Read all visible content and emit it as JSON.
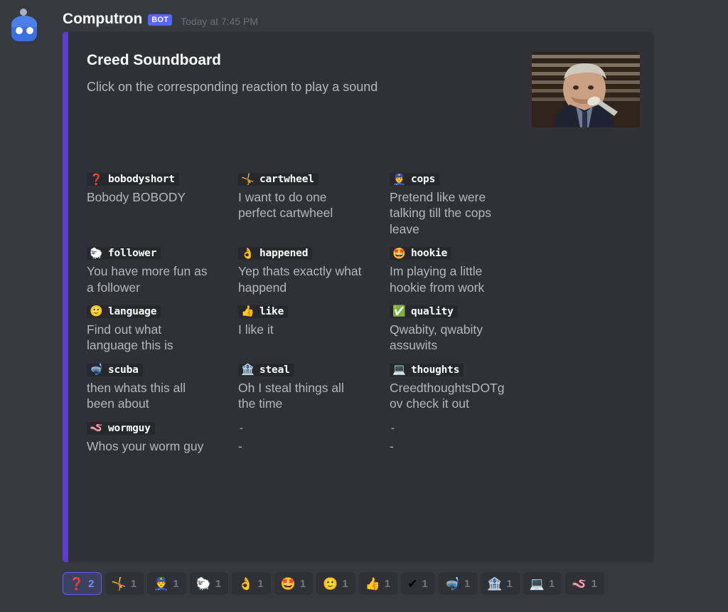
{
  "message": {
    "author": "Computron",
    "bot_tag": "BOT",
    "timestamp": "Today at 7:45 PM",
    "avatar_icon": "robot-avatar-icon"
  },
  "embed": {
    "accent_color": "#5b3ecc",
    "background_color": "#2f3136",
    "title": "Creed Soundboard",
    "description": "Click on the corresponding reaction to play a sound",
    "thumbnail_alt": "man-in-suit-eating-with-spoon-photo",
    "fields": [
      {
        "emoji": "❓",
        "emoji_name": "red-question-mark-icon",
        "name": "bobodyshort",
        "value": "Bobody BOBODY"
      },
      {
        "emoji": "🤸",
        "emoji_name": "cartwheel-person-icon",
        "name": "cartwheel",
        "value": "I want to do one perfect cartwheel"
      },
      {
        "emoji": "👮",
        "emoji_name": "police-officer-icon",
        "name": "cops",
        "value": "Pretend like were talking till the cops leave"
      },
      {
        "emoji": "🐑",
        "emoji_name": "sheep-icon",
        "name": "follower",
        "value": "You have more fun as a follower"
      },
      {
        "emoji": "👌",
        "emoji_name": "ok-hand-icon",
        "name": "happened",
        "value": "Yep thats exactly what happend"
      },
      {
        "emoji": "🤩",
        "emoji_name": "winking-face-icon",
        "name": "hookie",
        "value": "Im playing a little hookie from work"
      },
      {
        "emoji": "🙂",
        "emoji_name": "slight-smile-icon",
        "name": "language",
        "value": "Find out what language this is"
      },
      {
        "emoji": "👍",
        "emoji_name": "thumbs-up-icon",
        "name": "like",
        "value": "I like it"
      },
      {
        "emoji": "✅",
        "emoji_name": "green-check-mark-icon",
        "name": "quality",
        "value": "Qwabity, qwabity assuwits"
      },
      {
        "emoji": "🤿",
        "emoji_name": "diving-mask-icon",
        "name": "scuba",
        "value": "then whats this all been about"
      },
      {
        "emoji": "🏦",
        "emoji_name": "bank-icon",
        "name": "steal",
        "value": "Oh I steal things all the time"
      },
      {
        "emoji": "💻",
        "emoji_name": "laptop-icon",
        "name": "thoughts",
        "value": "CreedthoughtsDOTg ov check it out"
      },
      {
        "emoji": "🪱",
        "emoji_name": "worm-icon",
        "name": "wormguy",
        "value": "Whos your worm guy"
      },
      {
        "emoji": "",
        "emoji_name": "empty-icon",
        "name": "-",
        "value": "-"
      },
      {
        "emoji": "",
        "emoji_name": "empty-icon",
        "name": "-",
        "value": "-"
      }
    ]
  },
  "reactions": [
    {
      "emoji": "❓",
      "emoji_name": "red-question-mark-icon",
      "count": "2",
      "active": true
    },
    {
      "emoji": "🤸",
      "emoji_name": "cartwheel-person-icon",
      "count": "1",
      "active": false
    },
    {
      "emoji": "👮",
      "emoji_name": "police-officer-icon",
      "count": "1",
      "active": false
    },
    {
      "emoji": "🐑",
      "emoji_name": "sheep-icon",
      "count": "1",
      "active": false
    },
    {
      "emoji": "👌",
      "emoji_name": "ok-hand-icon",
      "count": "1",
      "active": false
    },
    {
      "emoji": "🤩",
      "emoji_name": "winking-face-icon",
      "count": "1",
      "active": false
    },
    {
      "emoji": "🙂",
      "emoji_name": "slight-smile-icon",
      "count": "1",
      "active": false
    },
    {
      "emoji": "👍",
      "emoji_name": "thumbs-up-icon",
      "count": "1",
      "active": false
    },
    {
      "emoji": "✔",
      "emoji_name": "check-mark-icon",
      "count": "1",
      "active": false
    },
    {
      "emoji": "🤿",
      "emoji_name": "diving-mask-icon",
      "count": "1",
      "active": false
    },
    {
      "emoji": "🏦",
      "emoji_name": "bank-icon",
      "count": "1",
      "active": false
    },
    {
      "emoji": "💻",
      "emoji_name": "laptop-icon",
      "count": "1",
      "active": false
    },
    {
      "emoji": "🪱",
      "emoji_name": "worm-icon",
      "count": "1",
      "active": false
    }
  ]
}
